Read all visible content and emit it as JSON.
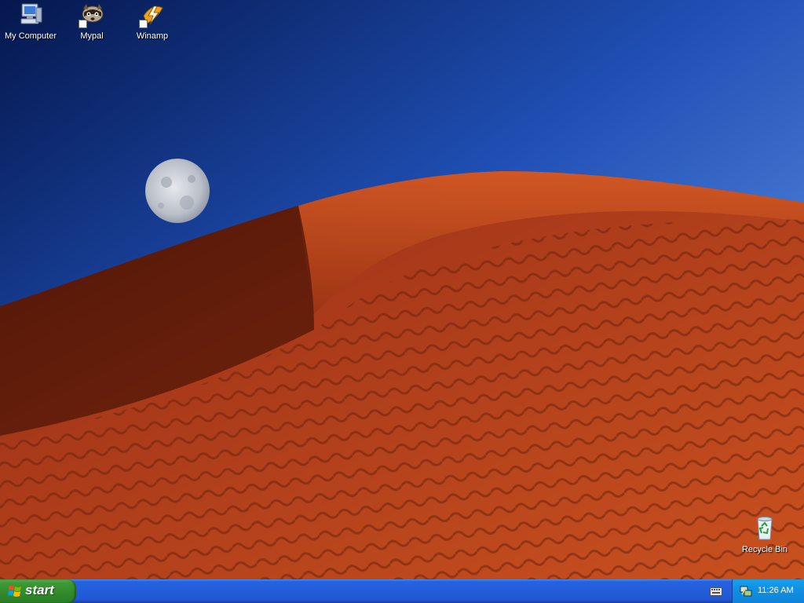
{
  "desktop": {
    "icons": [
      {
        "label": "My Computer",
        "icon": "my-computer-icon",
        "shortcut": false
      },
      {
        "label": "Mypal",
        "icon": "mypal-raccoon-icon",
        "shortcut": true
      },
      {
        "label": "Winamp",
        "icon": "winamp-lightning-icon",
        "shortcut": true
      },
      {
        "label": "Recycle Bin",
        "icon": "recycle-bin-icon",
        "shortcut": false
      }
    ]
  },
  "taskbar": {
    "start_label": "start",
    "clock": "11:26 AM",
    "tray_icons": [
      "network-icon",
      "keyboard-icon"
    ]
  },
  "colors": {
    "taskbar_blue": "#245edb",
    "start_green": "#318a2b",
    "tray_blue": "#1290e3",
    "sky_top": "#0a2a6e",
    "sky_bottom": "#5a93e8",
    "dune": "#b8421a"
  }
}
